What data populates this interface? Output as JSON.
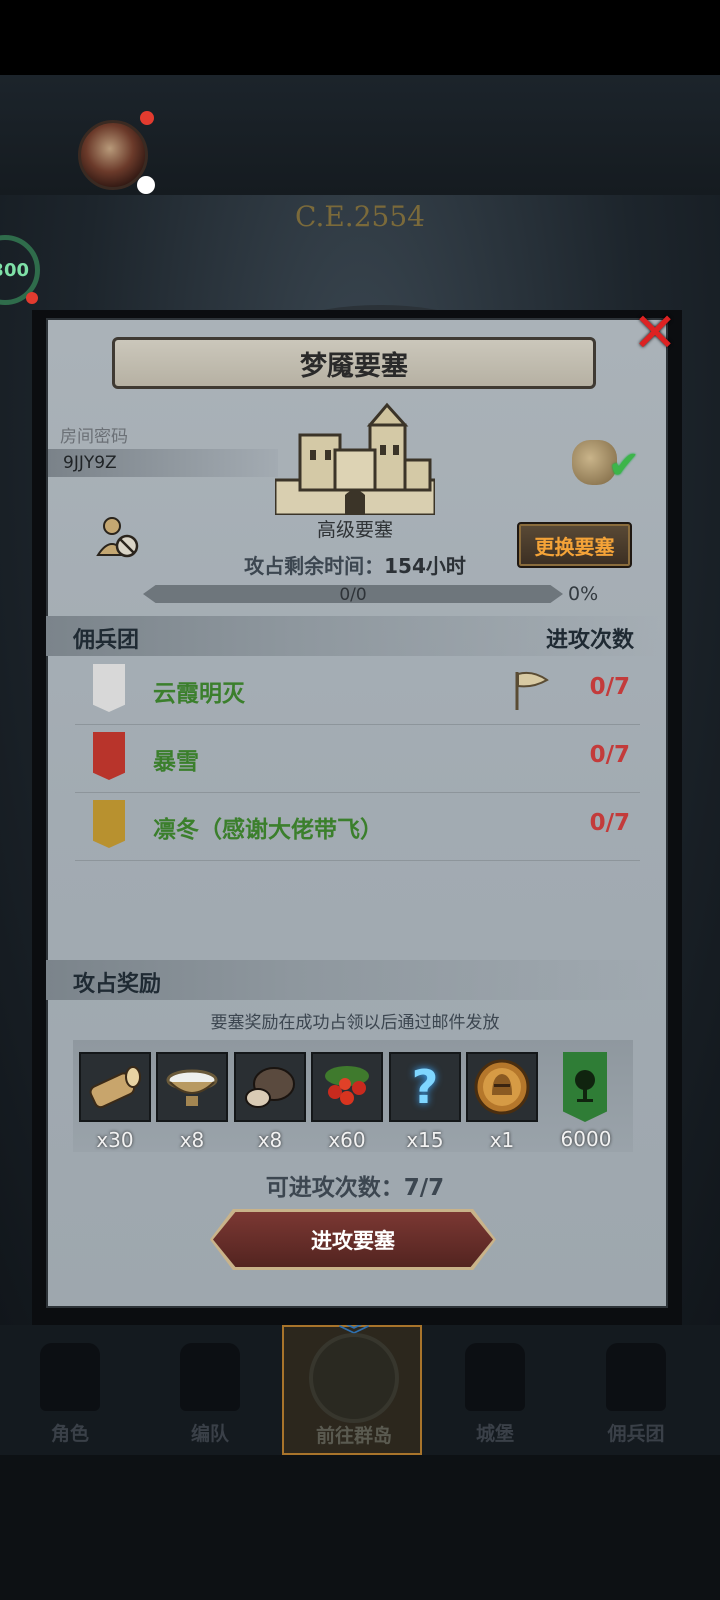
{
  "header": {
    "era": "C.E.2554",
    "side_gauge": "300"
  },
  "dialog": {
    "title": "梦魇要塞",
    "room_password_label": "房间密码",
    "room_password": "9JJY9Z",
    "fortress_type": "高级要塞",
    "change_button": "更换要塞",
    "time_label": "攻占剩余时间：",
    "time_value": "154小时",
    "progress_text": "0/0",
    "progress_fraction": 0,
    "progress_percent": "0%",
    "close_icon": "close-x-icon"
  },
  "guilds": {
    "header_left": "佣兵团",
    "header_right": "进攻次数",
    "rows": [
      {
        "name": "云霞明灭",
        "count": "0/7",
        "emblem_color": "#d8d8d8",
        "emblem_icon": "trident-icon",
        "has_flag": true
      },
      {
        "name": "暴雪",
        "count": "0/7",
        "emblem_color": "#b8342b",
        "emblem_icon": "wolf-icon",
        "has_flag": false
      },
      {
        "name": "凛冬（感谢大佬带飞）",
        "count": "0/7",
        "emblem_color": "#b8912f",
        "emblem_icon": "sun-icon",
        "has_flag": false
      }
    ]
  },
  "rewards": {
    "title": "攻占奖励",
    "note": "要塞奖励在成功占领以后通过邮件发放",
    "items": [
      {
        "icon": "log-icon",
        "qty": "x30"
      },
      {
        "icon": "milk-bowl-icon",
        "qty": "x8"
      },
      {
        "icon": "truffle-icon",
        "qty": "x8"
      },
      {
        "icon": "berries-icon",
        "qty": "x60"
      },
      {
        "icon": "mystery-question-icon",
        "qty": "x15"
      },
      {
        "icon": "helmet-medal-icon",
        "qty": "x1"
      }
    ],
    "banner": {
      "icon": "tree-banner-icon",
      "qty": "6000"
    }
  },
  "attack": {
    "count_label": "可进攻次数：",
    "count_value": "7/7",
    "button": "进攻要塞"
  },
  "nav": [
    {
      "label": "角色",
      "active": false
    },
    {
      "label": "编队",
      "active": false
    },
    {
      "label": "前往群岛",
      "active": true
    },
    {
      "label": "城堡",
      "active": false
    },
    {
      "label": "佣兵团",
      "active": false
    }
  ]
}
